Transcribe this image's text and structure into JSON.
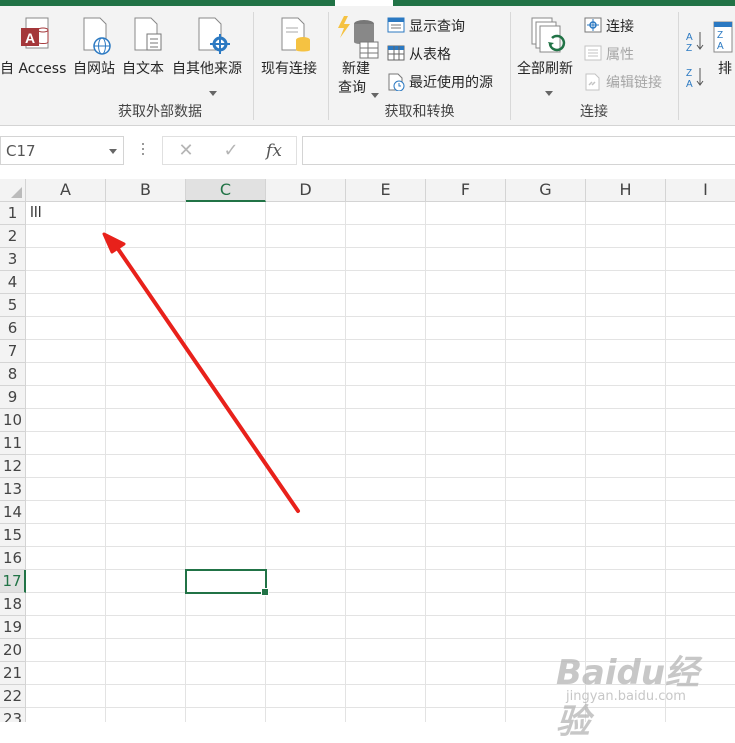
{
  "ribbon": {
    "groups": [
      {
        "label": "获取外部数据"
      },
      {
        "label": "获取和转换"
      },
      {
        "label": "连接"
      }
    ],
    "external": [
      {
        "label": "自 Access",
        "icon": "access-icon"
      },
      {
        "label": "自网站",
        "icon": "web-icon"
      },
      {
        "label": "自文本",
        "icon": "text-file-icon"
      },
      {
        "label": "自其他来源",
        "icon": "other-sources-icon"
      },
      {
        "label": "现有连接",
        "icon": "existing-connections-icon"
      }
    ],
    "transform": {
      "new_query_line1": "新建",
      "new_query_line2": "查询",
      "show_queries": "显示查询",
      "from_table": "从表格",
      "recent_sources": "最近使用的源"
    },
    "connections": {
      "refresh_all": "全部刷新",
      "connections": "连接",
      "properties": "属性",
      "edit_links": "编辑链接"
    },
    "sort": {
      "label": "排"
    }
  },
  "formula_bar": {
    "name_box": "C17",
    "cancel": "✕",
    "enter": "✓",
    "fx": "fx",
    "formula": ""
  },
  "sheet": {
    "columns": [
      "A",
      "B",
      "C",
      "D",
      "E",
      "F",
      "G",
      "H",
      "I"
    ],
    "rows": [
      "1",
      "2",
      "3",
      "4",
      "5",
      "6",
      "7",
      "8",
      "9",
      "10",
      "11",
      "12",
      "13",
      "14",
      "15",
      "16",
      "17",
      "18",
      "19",
      "20",
      "21",
      "22",
      "23"
    ],
    "selected_cell": "C17",
    "cells": {
      "A1": "lll"
    }
  },
  "colors": {
    "accent": "#217346",
    "annotation_arrow": "#e8211b"
  },
  "watermark": {
    "main": "Baidu经验",
    "sub": "jingyan.baidu.com"
  }
}
